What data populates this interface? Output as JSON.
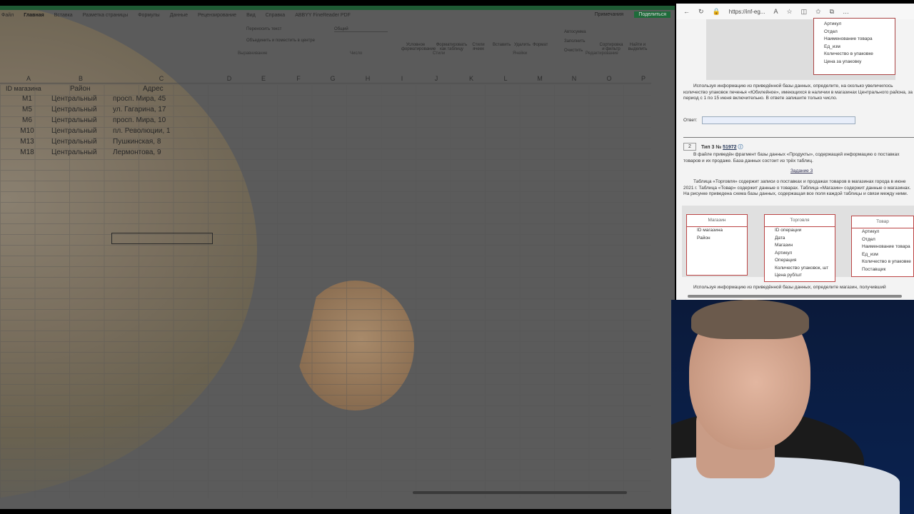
{
  "excel": {
    "ribbon_tabs": [
      "Файл",
      "Главная",
      "Вставка",
      "Разметка страницы",
      "Формулы",
      "Данные",
      "Рецензирование",
      "Вид",
      "Справка",
      "ABBYY FineReader PDF"
    ],
    "active_tab": "Главная",
    "notes_label": "Примечания",
    "share_label": "Поделиться",
    "ribbon": {
      "wrap_text": "Переносить текст",
      "merge_center": "Объединить и поместить в центре",
      "number_format": "Общий",
      "cond_format": "Условное форматирование",
      "format_table": "Форматировать как таблицу",
      "cell_styles": "Стили ячеек",
      "insert": "Вставить",
      "delete": "Удалить",
      "format": "Формат",
      "autosum": "Автосумма",
      "fill": "Заполнить",
      "clear": "Очистить",
      "sort_filter": "Сортировка и фильтр",
      "find_select": "Найти и выделить"
    },
    "groups": [
      "Выравнивание",
      "Число",
      "Стили",
      "Ячейки",
      "Редактирование"
    ],
    "columns": [
      "A",
      "B",
      "C",
      "D",
      "E",
      "F",
      "G",
      "H",
      "I",
      "J",
      "K",
      "L",
      "M",
      "N",
      "O",
      "P"
    ],
    "table": {
      "headers": [
        "ID магазина",
        "Район",
        "Адрес"
      ],
      "rows": [
        [
          "M1",
          "Центральный",
          "просп. Мира, 45"
        ],
        [
          "M5",
          "Центральный",
          "ул. Гагарина, 17"
        ],
        [
          "M6",
          "Центральный",
          "просп. Мира, 10"
        ],
        [
          "M10",
          "Центральный",
          "пл. Революции, 1"
        ],
        [
          "M13",
          "Центральный",
          "Пушкинская, 8"
        ],
        [
          "M18",
          "Центральный",
          "Лермонтова, 9"
        ]
      ]
    }
  },
  "browser": {
    "url": "https://inf-eg...",
    "schema_top": [
      "Артикул",
      "Отдел",
      "Наименование товара",
      "Ед_изм",
      "Количество в упаковке",
      "Цена за упаковку"
    ],
    "q1_text": "Используя информацию из приведённой базы данных, определите, на сколько увеличилось количество упаковок печенья «Юбилейное», имеющихся в наличии в магазинах Центрального района, за период с 1 по 15 июня включительно. В ответе запишите только число.",
    "answer_label": "Ответ:",
    "task_number": "2",
    "task_type": "Тип 3 №",
    "task_id": "51972",
    "intro": "В файле приведён фрагмент базы данных «Продукты», содержащей информацию о поставках товаров и их продаже. База данных состоит из трёх таблиц.",
    "zadanie_link": "Задание 3",
    "desc": "Таблица «Торговля» содержит записи о поставках и продажах товаров в магазинах города в июне 2021 г. Таблица «Товар» содержит данные о товарах. Таблица «Магазин» содержит данные о магазинах. На рисунке приведена схема базы данных, содержащая все поля каждой таблицы и связи между ними.",
    "tables": [
      {
        "title": "Магазин",
        "fields": [
          "ID магазина",
          "Район"
        ]
      },
      {
        "title": "Торговля",
        "fields": [
          "ID операции",
          "Дата",
          "Магазин",
          "Артикул",
          "Операция",
          "Количество упаковок, шт",
          "Цена руб/шт"
        ]
      },
      {
        "title": "Товар",
        "fields": [
          "Артикул",
          "Отдел",
          "Наименование товара",
          "Ед_изм",
          "Количество в упаковке",
          "Поставщик"
        ]
      }
    ],
    "q2_text": "Используя информацию из приведённой базы данных, определите магазин, получивший"
  }
}
